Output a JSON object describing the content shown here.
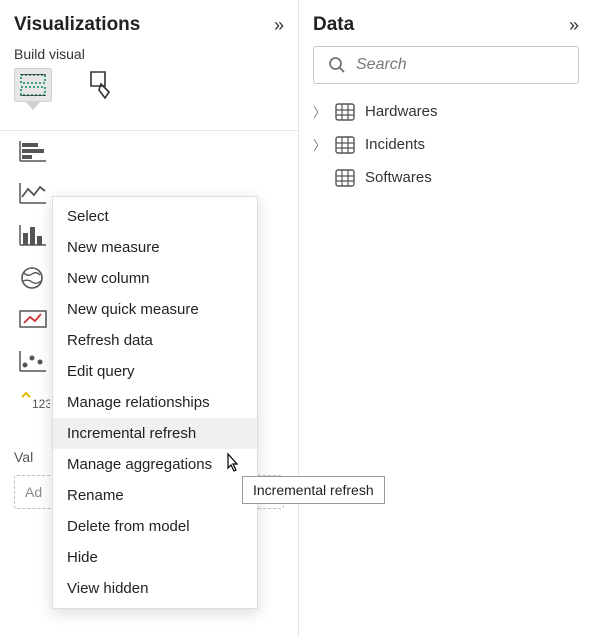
{
  "visualizations": {
    "title": "Visualizations",
    "subheader": "Build visual",
    "values_label": "Val",
    "values_placeholder": "Ad"
  },
  "data_pane": {
    "title": "Data",
    "search_placeholder": "Search",
    "tables": [
      {
        "name": "Hardwares",
        "expanded": false
      },
      {
        "name": "Incidents",
        "expanded": false
      },
      {
        "name": "Softwares",
        "expanded": false
      }
    ]
  },
  "context_menu": {
    "items": [
      "Select",
      "New measure",
      "New column",
      "New quick measure",
      "Refresh data",
      "Edit query",
      "Manage relationships",
      "Incremental refresh",
      "Manage aggregations",
      "Rename",
      "Delete from model",
      "Hide",
      "View hidden"
    ],
    "hovered_index": 7
  },
  "tooltip": "Incremental refresh"
}
